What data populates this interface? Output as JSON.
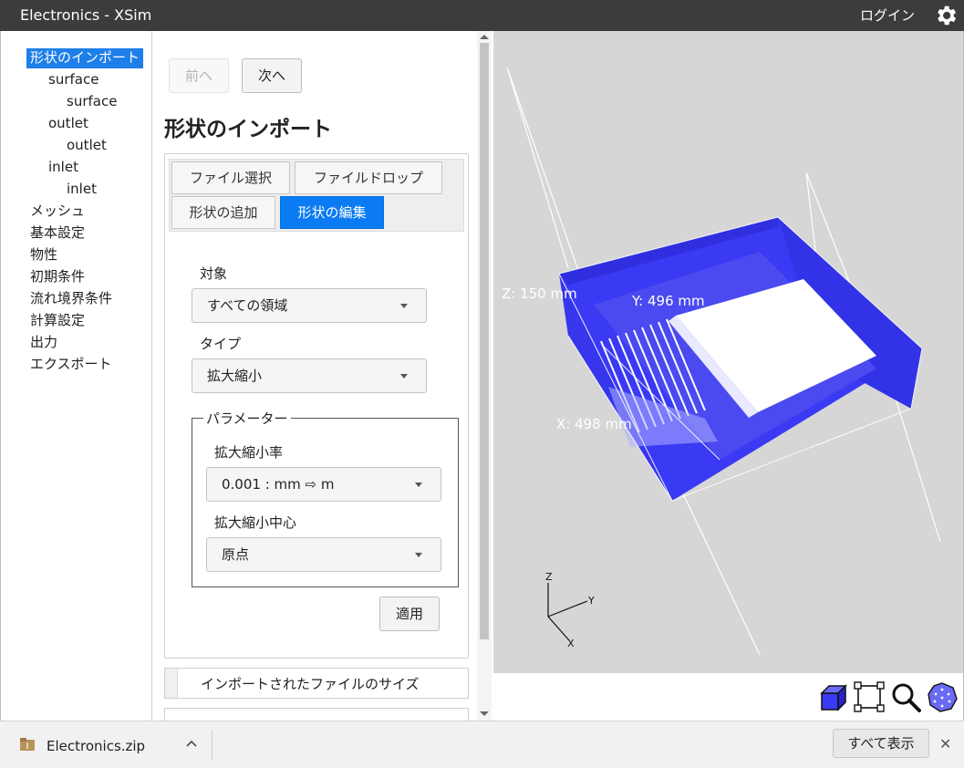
{
  "window": {
    "title": "Electronics - XSim",
    "login": "ログイン"
  },
  "tree": {
    "items": [
      {
        "label": "形状のインポート",
        "selected": true
      },
      {
        "label": "surface"
      },
      {
        "label": "surface"
      },
      {
        "label": "outlet"
      },
      {
        "label": "outlet"
      },
      {
        "label": "inlet"
      },
      {
        "label": "inlet"
      },
      {
        "label": "メッシュ"
      },
      {
        "label": "基本設定"
      },
      {
        "label": "物性"
      },
      {
        "label": "初期条件"
      },
      {
        "label": "流れ境界条件"
      },
      {
        "label": "計算設定"
      },
      {
        "label": "出力"
      },
      {
        "label": "エクスポート"
      }
    ]
  },
  "panel": {
    "prev": "前へ",
    "next": "次へ",
    "title": "形状のインポート",
    "tabs": [
      "ファイル選択",
      "ファイルドロップ",
      "形状の追加",
      "形状の編集"
    ],
    "active_tab": "形状の編集",
    "target_label": "対象",
    "target_value": "すべての領域",
    "type_label": "タイプ",
    "type_value": "拡大縮小",
    "params_legend": "パラメーター",
    "scale_label": "拡大縮小率",
    "scale_value": "0.001 : mm ⇨ m",
    "center_label": "拡大縮小中心",
    "center_value": "原点",
    "apply": "適用",
    "imported_size": "インポートされたファイルのサイズ"
  },
  "viewport": {
    "dim_z": "Z: 150 mm",
    "dim_y": "Y: 496 mm",
    "dim_x": "X: 498 mm",
    "axis_z": "Z",
    "axis_y": "Y",
    "axis_x": "X",
    "box_color": "#3a3af5",
    "background": "#d6d6d6"
  },
  "downloads": {
    "file": "Electronics.zip",
    "show_all": "すべて表示",
    "close": "✕"
  }
}
